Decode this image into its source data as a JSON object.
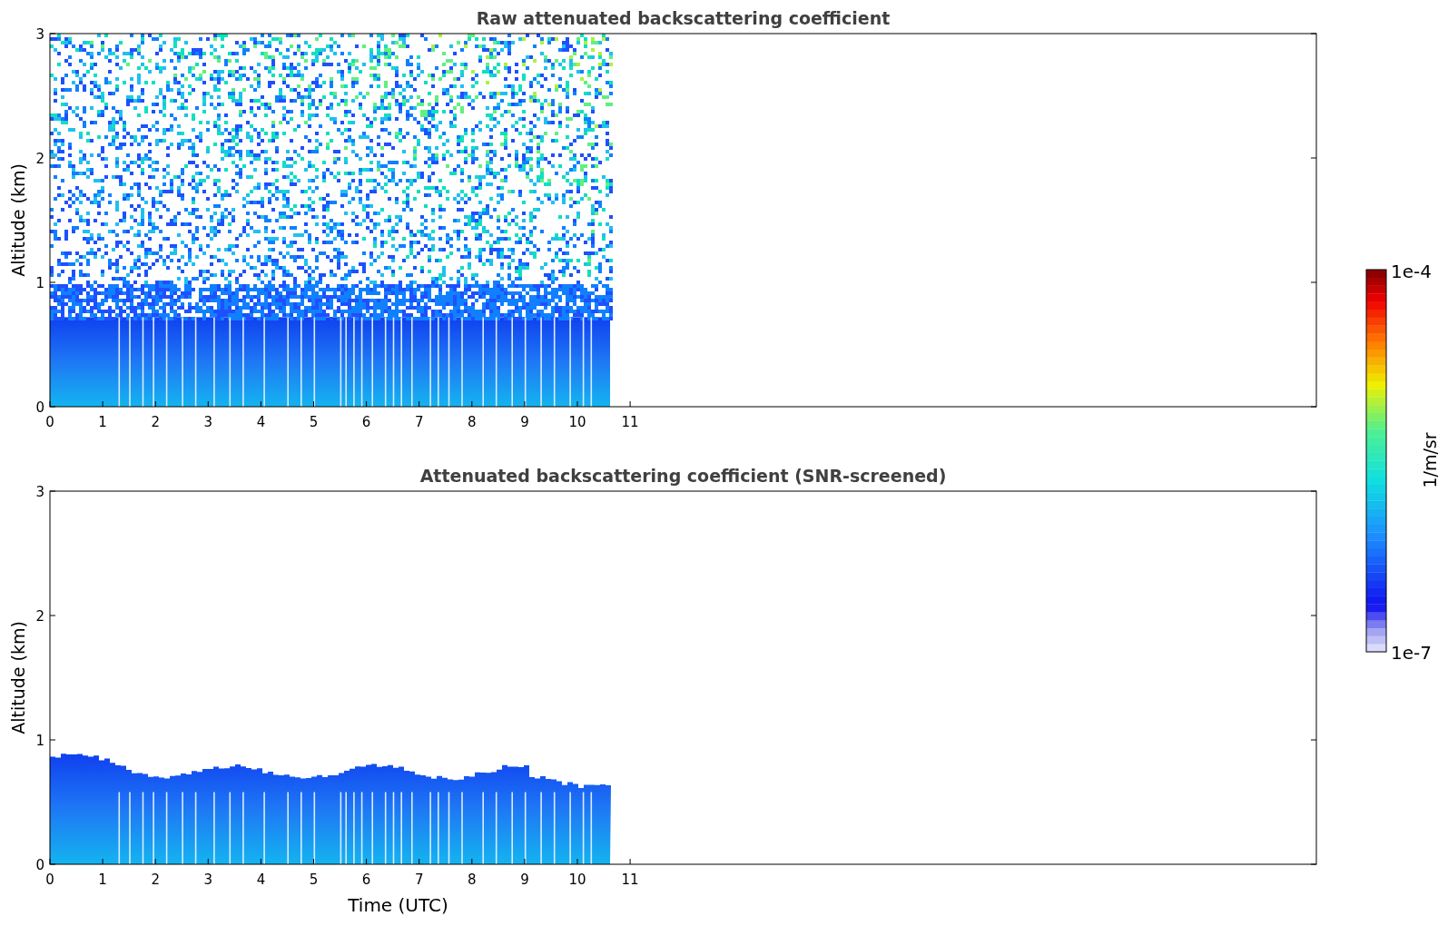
{
  "panels": [
    {
      "kind": "raw",
      "title": "Raw attenuated backscattering coefficient",
      "ylabel": "Altitude (km)",
      "yticks": [
        "3",
        "2",
        "1",
        "0"
      ],
      "xticks": [
        "0",
        "1",
        "2",
        "3",
        "4",
        "5",
        "6",
        "7",
        "8",
        "9",
        "10",
        "11"
      ]
    },
    {
      "kind": "screened",
      "title": "Attenuated backscattering coefficient (SNR-screened)",
      "ylabel": "Altitude (km)",
      "yticks": [
        "3",
        "2",
        "1",
        "0"
      ],
      "xticks": [
        "0",
        "1",
        "2",
        "3",
        "4",
        "5",
        "6",
        "7",
        "8",
        "9",
        "10",
        "11"
      ],
      "xlabel": "Time (UTC)"
    }
  ],
  "colorbar": {
    "max_label": "1e-4",
    "min_label": "1e-7",
    "unit": "1/m/sr"
  }
}
